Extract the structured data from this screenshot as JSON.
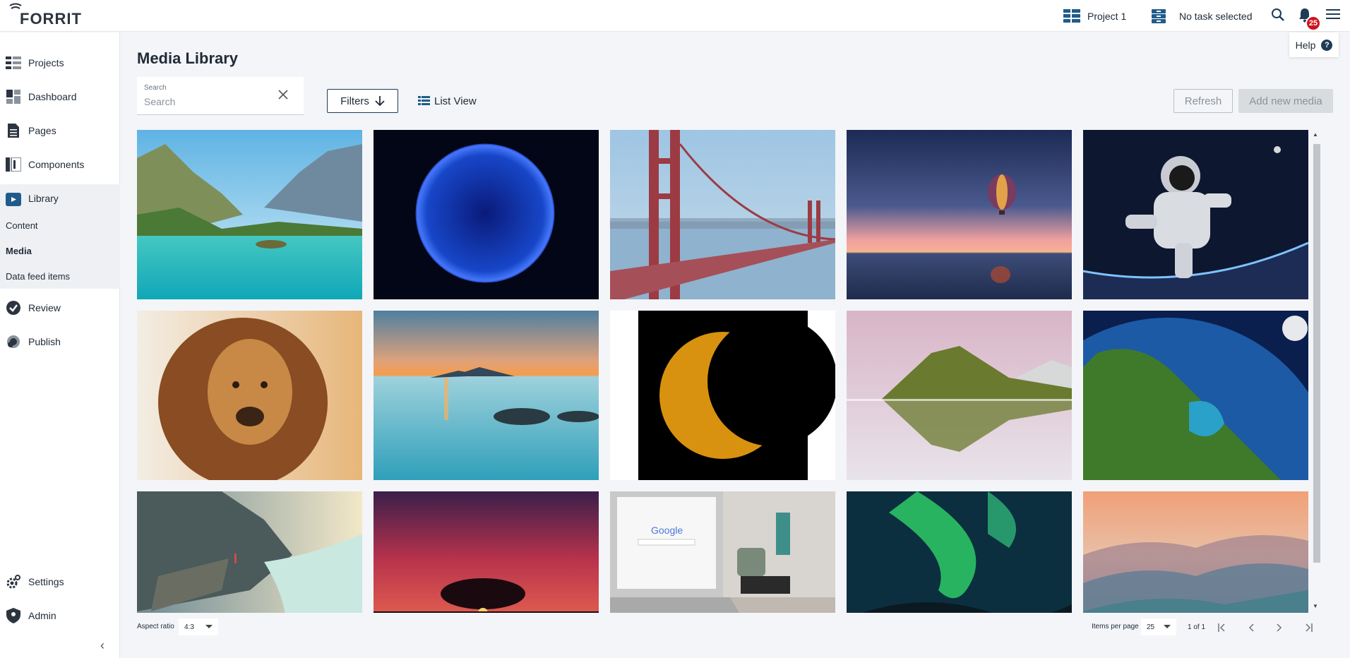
{
  "app": {
    "logo_text": "FORRIT",
    "accent": "#1f3b57"
  },
  "topbar": {
    "project_label": "Project 1",
    "task_label": "No task selected",
    "notification_count": "25",
    "help_label": "Help",
    "help_glyph": "?"
  },
  "sidebar": {
    "items": [
      {
        "label": "Projects",
        "icon": "projects-icon"
      },
      {
        "label": "Dashboard",
        "icon": "dashboard-icon"
      },
      {
        "label": "Pages",
        "icon": "pages-icon"
      },
      {
        "label": "Components",
        "icon": "components-icon"
      },
      {
        "label": "Library",
        "icon": "library-icon"
      },
      {
        "label": "Review",
        "icon": "review-icon"
      },
      {
        "label": "Publish",
        "icon": "publish-icon"
      },
      {
        "label": "Settings",
        "icon": "settings-icon"
      },
      {
        "label": "Admin",
        "icon": "admin-icon"
      }
    ],
    "library_sub": [
      {
        "label": "Content"
      },
      {
        "label": "Media"
      },
      {
        "label": "Data feed items"
      }
    ],
    "collapse_glyph": "‹"
  },
  "main": {
    "title": "Media Library",
    "search": {
      "label": "Search",
      "placeholder": "Search"
    },
    "filters_label": "Filters",
    "list_view_label": "List View",
    "refresh_label": "Refresh",
    "add_label": "Add new media"
  },
  "media": [
    {
      "subject": "fjord lake",
      "scene": "lake"
    },
    {
      "subject": "blue sun",
      "scene": "bluesun"
    },
    {
      "subject": "golden gate bridge",
      "scene": "bridge"
    },
    {
      "subject": "hot air balloon sunset",
      "scene": "balloon"
    },
    {
      "subject": "astronaut",
      "scene": "astronaut"
    },
    {
      "subject": "lion",
      "scene": "lion"
    },
    {
      "subject": "sunset sea",
      "scene": "sunsetsea"
    },
    {
      "subject": "solar eclipse",
      "scene": "eclipse"
    },
    {
      "subject": "mountain reflection",
      "scene": "mountain"
    },
    {
      "subject": "earth from space",
      "scene": "earth"
    },
    {
      "subject": "cliff lake",
      "scene": "cliff"
    },
    {
      "subject": "red sky tree",
      "scene": "redtree"
    },
    {
      "subject": "laptop google",
      "scene": "laptop"
    },
    {
      "subject": "aurora",
      "scene": "aurora"
    },
    {
      "subject": "misty hills",
      "scene": "hills"
    }
  ],
  "footer": {
    "aspect_label": "Aspect ratio",
    "aspect_value": "4:3",
    "items_per_page_label": "Items per page",
    "items_per_page_value": "25",
    "page_info": "1 of 1"
  }
}
